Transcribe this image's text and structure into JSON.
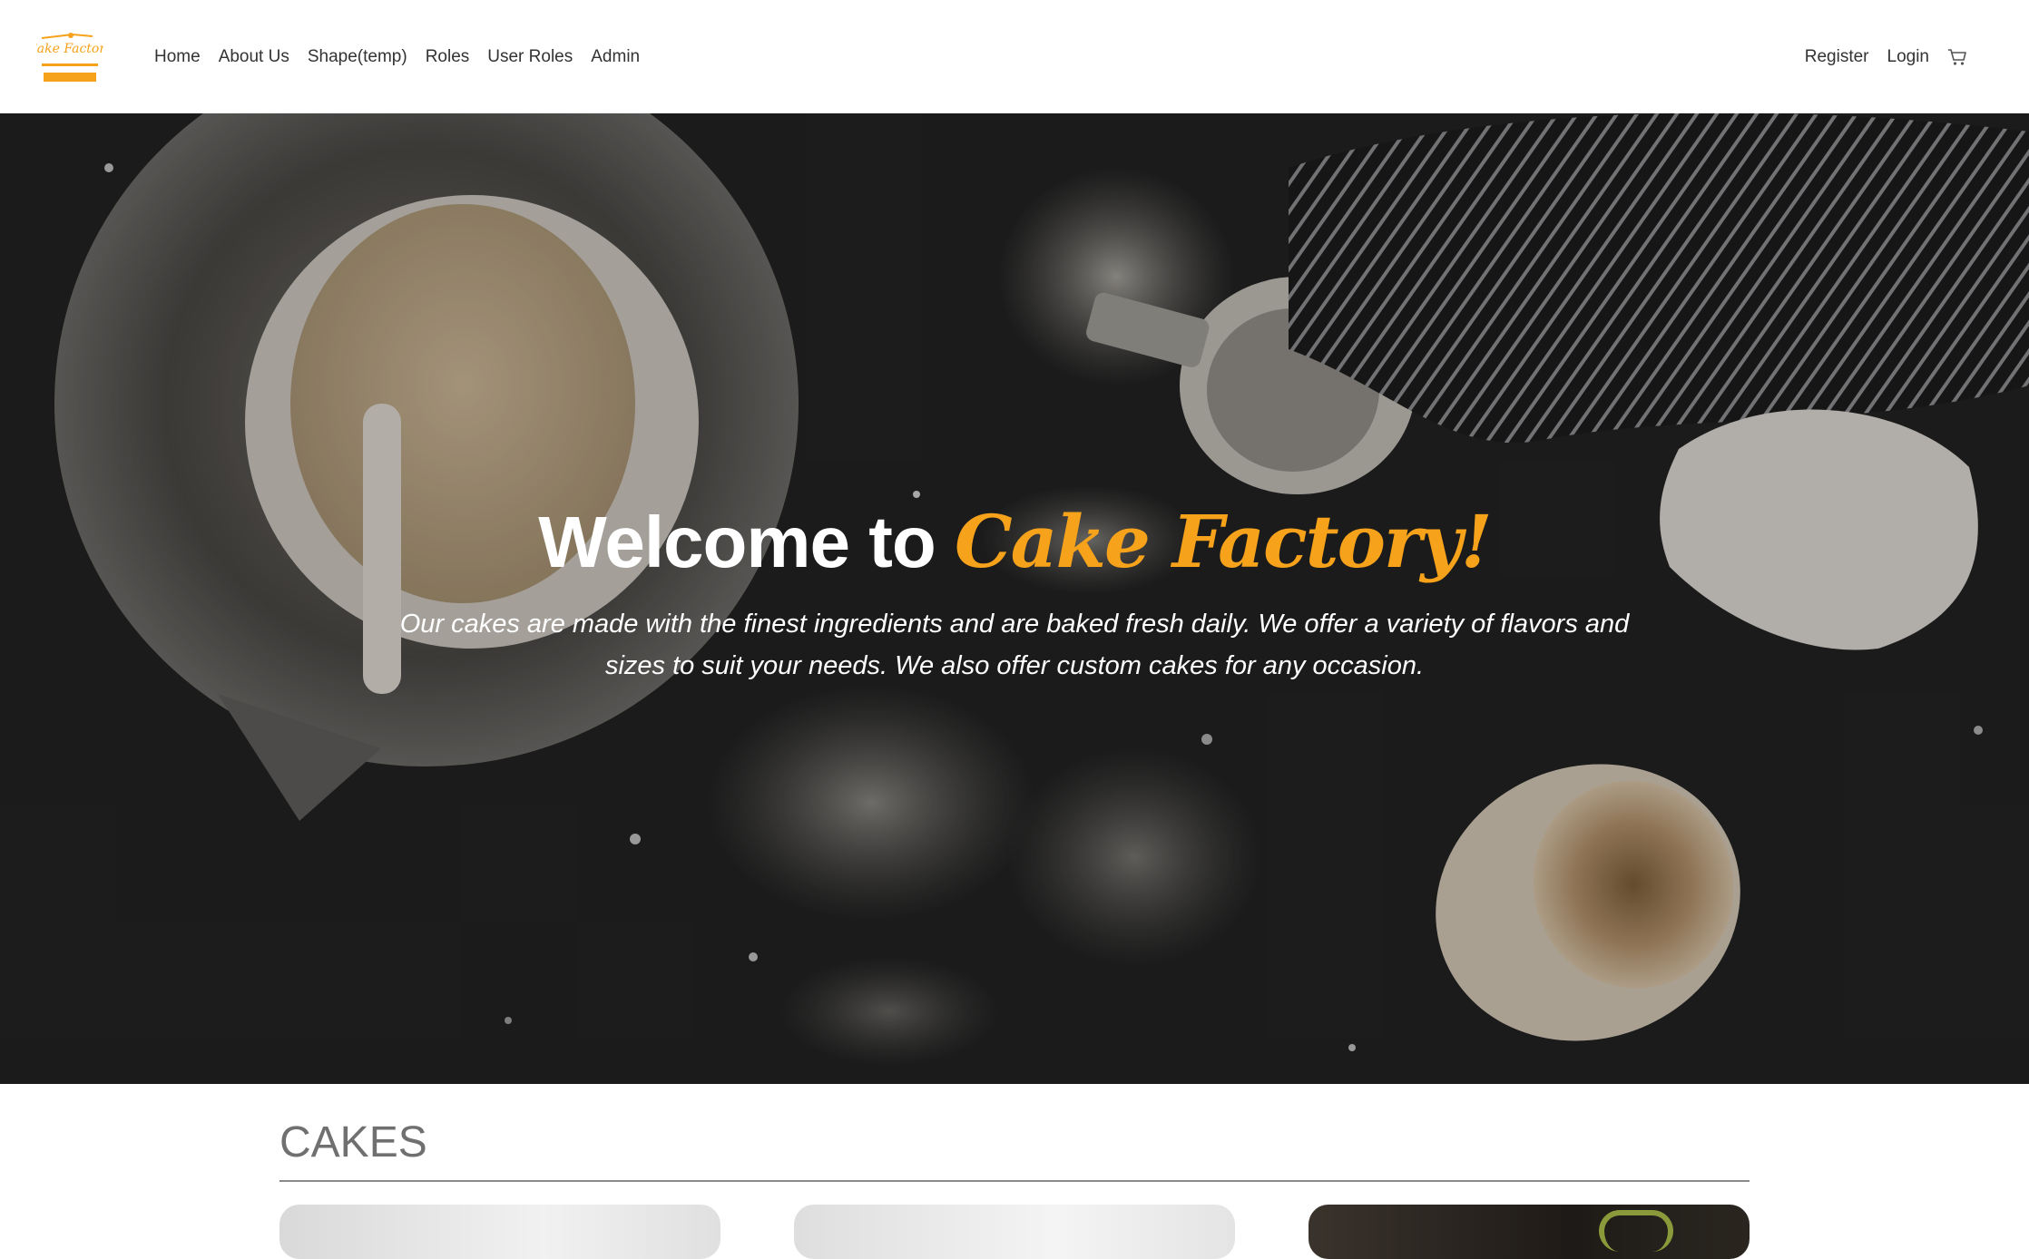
{
  "nav": {
    "logo_text": "Cake Factory",
    "links": [
      "Home",
      "About Us",
      "Shape(temp)",
      "Roles",
      "User Roles",
      "Admin"
    ],
    "register": "Register",
    "login": "Login",
    "cart_icon": "cart-icon"
  },
  "hero": {
    "title_prefix": "Welcome to ",
    "title_brand": "Cake Factory!",
    "description": "Our cakes are made with the finest ingredients and are baked fresh daily. We offer a variety of flavors and sizes to suit your needs. We also offer custom cakes for any occasion."
  },
  "cakes": {
    "title": "CAKES"
  },
  "colors": {
    "brand": "#f7a21b",
    "text": "#333333",
    "section_title": "#707070"
  }
}
